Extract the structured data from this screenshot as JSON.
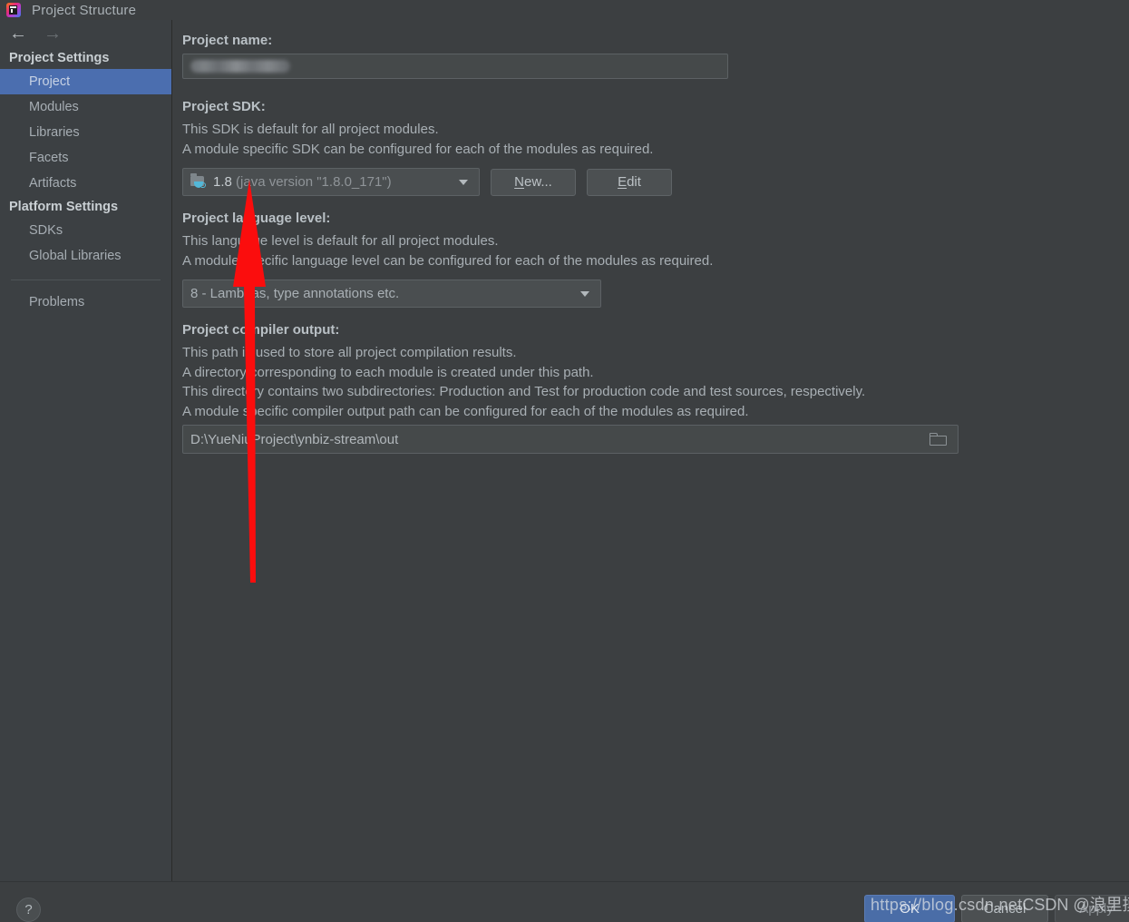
{
  "window": {
    "title": "Project Structure",
    "app_icon": "intellij-idea-logo"
  },
  "nav": {
    "back_icon": "arrow-left-icon",
    "back_glyph": "←",
    "forward_icon": "arrow-right-icon",
    "forward_glyph": "→"
  },
  "sidebar": {
    "groups": [
      {
        "header": "Project Settings",
        "items": [
          {
            "label": "Project",
            "selected": true
          },
          {
            "label": "Modules",
            "selected": false
          },
          {
            "label": "Libraries",
            "selected": false
          },
          {
            "label": "Facets",
            "selected": false
          },
          {
            "label": "Artifacts",
            "selected": false
          }
        ]
      },
      {
        "header": "Platform Settings",
        "items": [
          {
            "label": "SDKs",
            "selected": false
          },
          {
            "label": "Global Libraries",
            "selected": false
          }
        ]
      }
    ],
    "extra_items": [
      {
        "label": "Problems",
        "selected": false
      }
    ]
  },
  "main": {
    "project_name": {
      "label": "Project name:",
      "value": "",
      "redacted": true
    },
    "project_sdk": {
      "label": "Project SDK:",
      "descriptions": [
        "This SDK is default for all project modules.",
        "A module specific SDK can be configured for each of the modules as required."
      ],
      "selected_version": "1.8",
      "selected_detail": "(java version \"1.8.0_171\")",
      "icon": "jdk-folder-icon",
      "dropdown_icon": "chevron-down-icon",
      "new_button": "New...",
      "new_button_mnemonic": "N",
      "edit_button": "Edit",
      "edit_button_mnemonic": "E"
    },
    "language_level": {
      "label": "Project language level:",
      "descriptions": [
        "This language level is default for all project modules.",
        "A module specific language level can be configured for each of the modules as required."
      ],
      "selected": "8 - Lambdas, type annotations etc.",
      "dropdown_icon": "chevron-down-icon"
    },
    "compiler_output": {
      "label": "Project compiler output:",
      "descriptions": [
        "This path is used to store all project compilation results.",
        "A directory corresponding to each module is created under this path.",
        "This directory contains two subdirectories: Production and Test for production code and test sources, respectively.",
        "A module specific compiler output path can be configured for each of the modules as required."
      ],
      "value": "D:\\YueNiuProject\\ynbiz-stream\\out",
      "browse_icon": "folder-icon"
    }
  },
  "footer": {
    "help_label": "?",
    "help_icon": "question-mark-icon",
    "ok_label": "OK",
    "cancel_label": "Cancel",
    "apply_label": "Apply"
  },
  "annotation": {
    "arrow_icon": "red-up-arrow-annotation",
    "color": "#fb0d0d"
  },
  "watermark": {
    "url": "https://blog.csdn.net",
    "brand": "CSDN @浪里摸鱼"
  },
  "colors": {
    "window_background": "#3c3f41",
    "sidebar_background": "#3c4043",
    "selection_blue": "#4b6eaf",
    "primary_button": "#4a6da7",
    "text": "#a8afb4",
    "heading_text": "#b9c0c5",
    "annotation_red": "#fb0d0d"
  }
}
